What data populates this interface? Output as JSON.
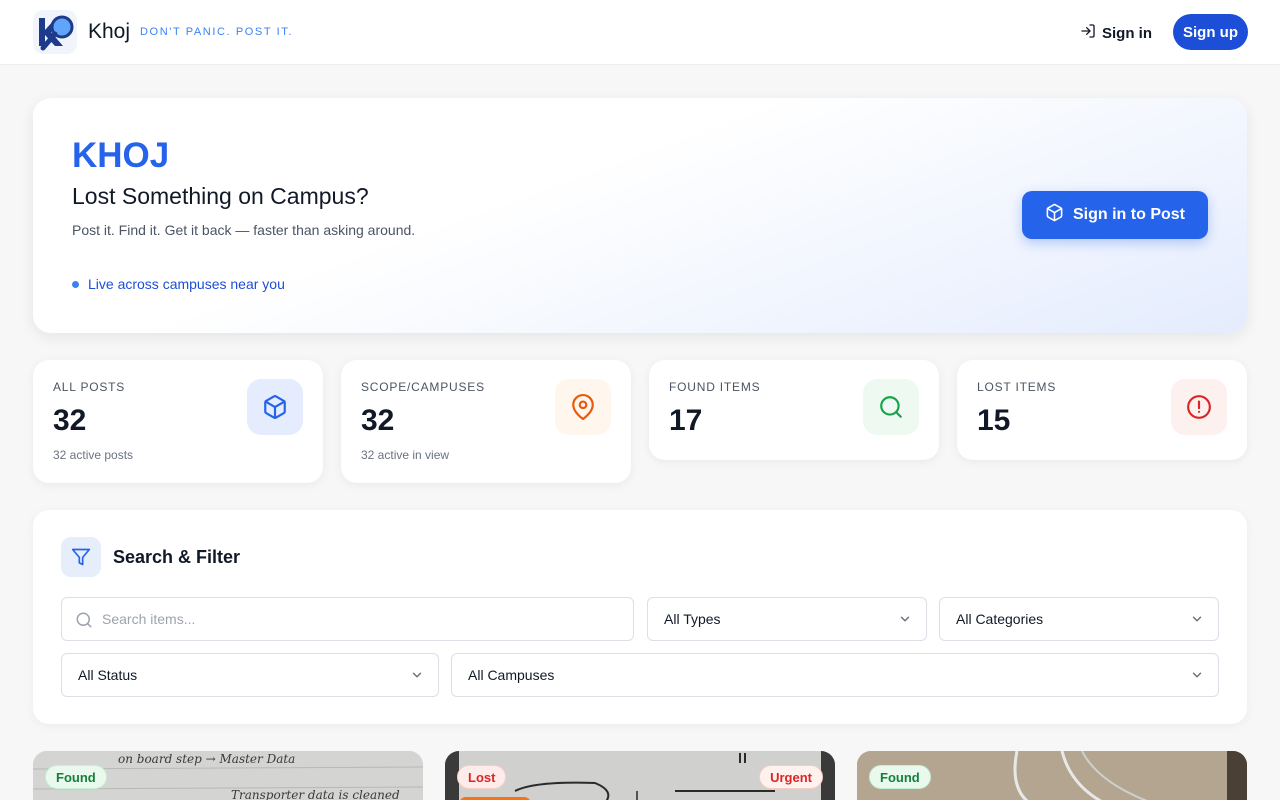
{
  "header": {
    "brand": "Khoj",
    "tagline": "DON'T PANIC. POST IT.",
    "signin_label": "Sign in",
    "signup_label": "Sign up"
  },
  "hero": {
    "title": "KHOJ",
    "subtitle": "Lost Something on Campus?",
    "description": "Post it. Find it. Get it back — faster than asking around.",
    "live_text": "Live across campuses near you",
    "cta_label": "Sign in to Post"
  },
  "stats": [
    {
      "label": "ALL POSTS",
      "value": "32",
      "note": "32 active posts",
      "icon": "box-icon",
      "color": "#2563eb"
    },
    {
      "label": "SCOPE/CAMPUSES",
      "value": "32",
      "note": "32 active in view",
      "icon": "map-pin-icon",
      "color": "#ea580c"
    },
    {
      "label": "FOUND ITEMS",
      "value": "17",
      "note": "",
      "icon": "search-icon",
      "color": "#16a34a"
    },
    {
      "label": "LOST ITEMS",
      "value": "15",
      "note": "",
      "icon": "alert-circle-icon",
      "color": "#dc2626"
    }
  ],
  "filters": {
    "title": "Search & Filter",
    "search_placeholder": "Search items...",
    "type_value": "All Types",
    "category_value": "All Categories",
    "status_value": "All Status",
    "campus_value": "All Campuses"
  },
  "cards": [
    {
      "badge": "Found",
      "handwriting_1": "on board step → Master Data",
      "handwriting_2": "Transporter data is cleaned"
    },
    {
      "badge": "Lost",
      "badge_2": "Urgent"
    },
    {
      "badge": "Found"
    }
  ]
}
